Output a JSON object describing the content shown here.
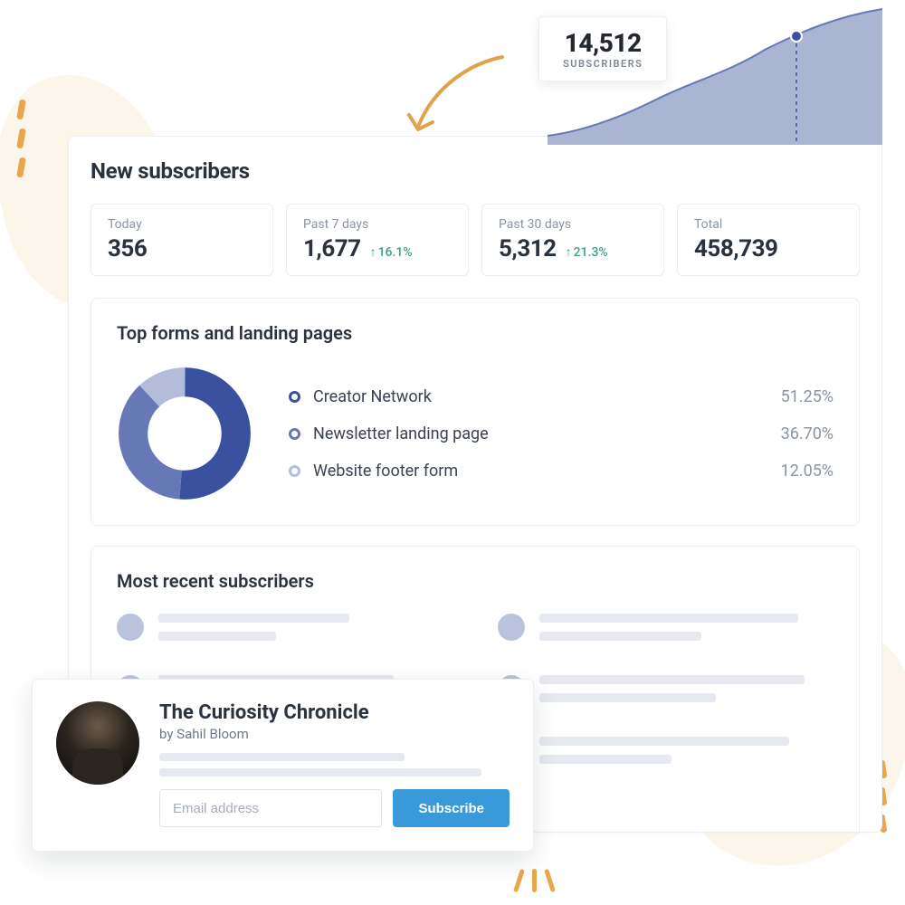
{
  "tooltip": {
    "value": "14,512",
    "label": "SUBSCRIBERS"
  },
  "dashboard": {
    "title": "New subscribers",
    "stats": [
      {
        "label": "Today",
        "value": "356",
        "delta": null
      },
      {
        "label": "Past 7 days",
        "value": "1,677",
        "delta": "16.1%"
      },
      {
        "label": "Past 30 days",
        "value": "5,312",
        "delta": "21.3%"
      },
      {
        "label": "Total",
        "value": "458,739",
        "delta": null
      }
    ],
    "forms": {
      "title": "Top forms and landing pages",
      "items": [
        {
          "name": "Creator Network",
          "pct": "51.25%",
          "color": "#3a519f"
        },
        {
          "name": "Newsletter landing page",
          "pct": "36.70%",
          "color": "#6678b6"
        },
        {
          "name": "Website footer form",
          "pct": "12.05%",
          "color": "#b3bcdb"
        }
      ]
    },
    "recent": {
      "title": "Most recent subscribers"
    }
  },
  "signup": {
    "title": "The Curiosity Chronicle",
    "byline": "by Sahil Bloom",
    "placeholder": "Email address",
    "button": "Subscribe"
  },
  "chart_data": {
    "type": "pie",
    "title": "Top forms and landing pages",
    "categories": [
      "Creator Network",
      "Newsletter landing page",
      "Website footer form"
    ],
    "values": [
      51.25,
      36.7,
      12.05
    ]
  }
}
